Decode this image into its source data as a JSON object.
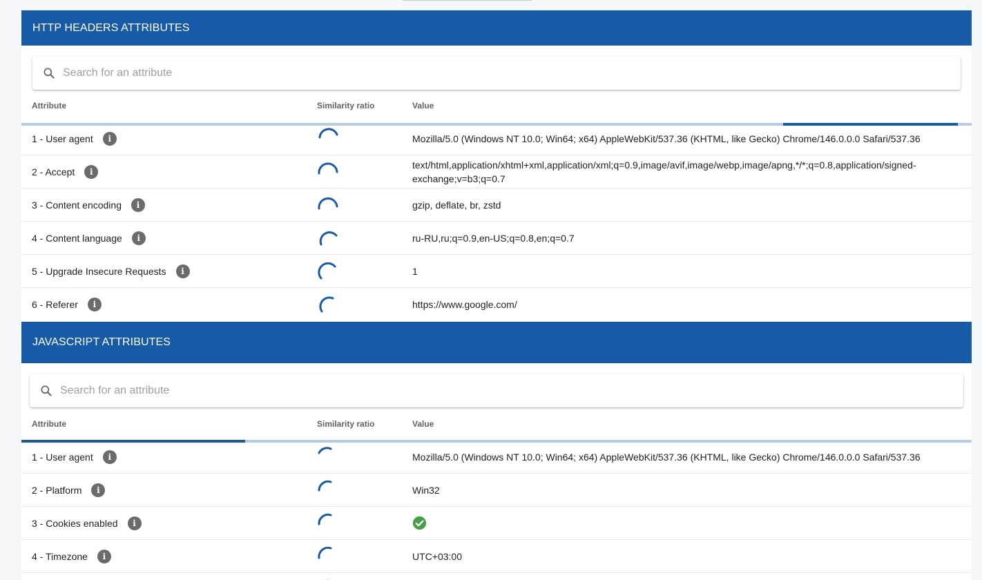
{
  "http_section": {
    "title": "HTTP HEADERS ATTRIBUTES",
    "search_placeholder": "Search for an attribute",
    "columns": {
      "attribute": "Attribute",
      "similarity": "Similarity ratio",
      "value": "Value"
    },
    "rows": [
      {
        "attribute": "1 - User agent",
        "value": "Mozilla/5.0 (Windows NT 10.0; Win64; x64) AppleWebKit/537.36 (KHTML, like Gecko) Chrome/146.0.0.0 Safari/537.36"
      },
      {
        "attribute": "2 - Accept",
        "value": "text/html,application/xhtml+xml,application/xml;q=0.9,image/avif,image/webp,image/apng,*/*;q=0.8,application/signed-exchange;v=b3;q=0.7"
      },
      {
        "attribute": "3 - Content encoding",
        "value": "gzip, deflate, br, zstd"
      },
      {
        "attribute": "4 - Content language",
        "value": "ru-RU,ru;q=0.9,en-US;q=0.8,en;q=0.7"
      },
      {
        "attribute": "5 - Upgrade Insecure Requests",
        "value": "1"
      },
      {
        "attribute": "6 - Referer",
        "value": "https://www.google.com/"
      }
    ]
  },
  "js_section": {
    "title": "JAVASCRIPT ATTRIBUTES",
    "search_placeholder": "Search for an attribute",
    "columns": {
      "attribute": "Attribute",
      "similarity": "Similarity ratio",
      "value": "Value"
    },
    "rows": [
      {
        "attribute": "1 - User agent",
        "value": "Mozilla/5.0 (Windows NT 10.0; Win64; x64) AppleWebKit/537.36 (KHTML, like Gecko) Chrome/146.0.0.0 Safari/537.36"
      },
      {
        "attribute": "2 - Platform",
        "value": "Win32"
      },
      {
        "attribute": "3 - Cookies enabled",
        "value_icon": "check-circle-icon"
      },
      {
        "attribute": "4 - Timezone",
        "value": "UTC+03:00"
      },
      {
        "attribute": "",
        "value": ""
      }
    ]
  },
  "info_icon_glyph": "i",
  "colors": {
    "header_bg": "#175aa8",
    "progress_track": "#b7cbe2",
    "spinner": "#175aa8",
    "check": "#43a047",
    "info_icon": "#6b6b6b"
  }
}
